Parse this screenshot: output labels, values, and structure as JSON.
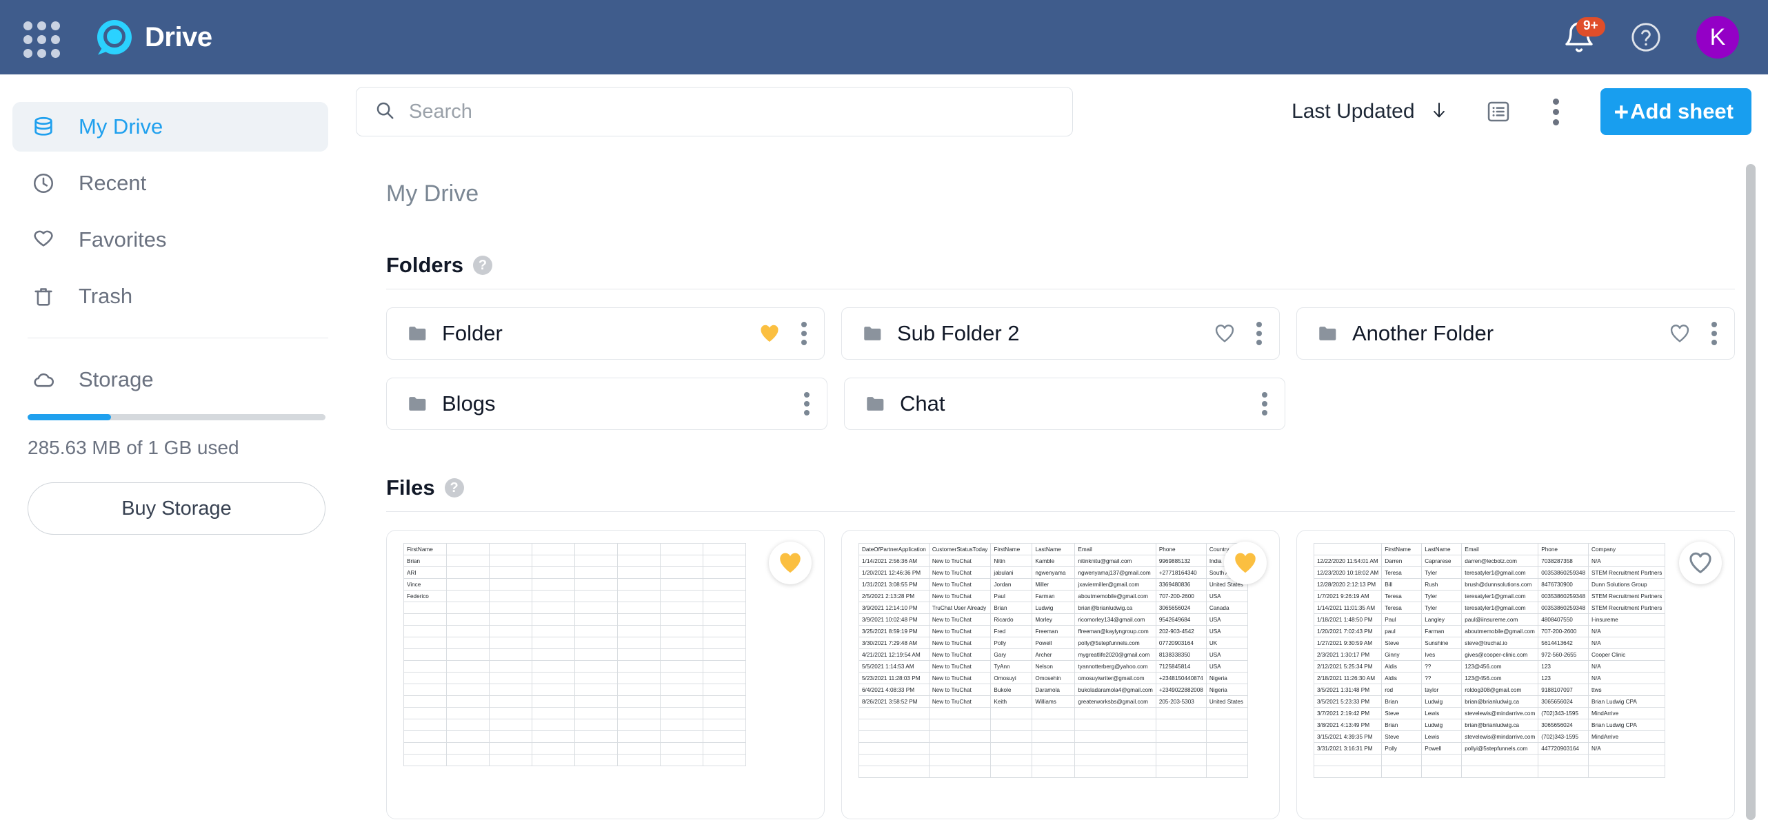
{
  "header": {
    "apps_icon": "apps-grid-icon",
    "logo_icon": "drive-logo-icon",
    "brand": "Drive",
    "notifications": {
      "icon": "bell-icon",
      "badge": "9+"
    },
    "help": {
      "icon": "help-circle-icon"
    },
    "avatar": {
      "initial": "K",
      "color": "#9400C6"
    }
  },
  "sidebar": {
    "items": [
      {
        "label": "My Drive",
        "icon": "database-icon",
        "active": true
      },
      {
        "label": "Recent",
        "icon": "clock-icon",
        "active": false
      },
      {
        "label": "Favorites",
        "icon": "heart-icon",
        "active": false
      },
      {
        "label": "Trash",
        "icon": "trash-icon",
        "active": false
      }
    ],
    "storage": {
      "label": "Storage",
      "icon": "cloud-icon",
      "usage_text": "285.63 MB of 1 GB used",
      "percent": 28,
      "bar_color": "#1FA0EE",
      "buy_label": "Buy Storage"
    }
  },
  "toolbar": {
    "search": {
      "placeholder": "Search",
      "value": "",
      "icon": "search-icon"
    },
    "sort_label": "Last Updated",
    "sort_direction_icon": "arrow-down-icon",
    "list_view_icon": "list-view-icon",
    "more_icon": "kebab-menu-icon",
    "add_sheet_label": "Add sheet",
    "add_sheet_plus": "+",
    "accent": "#189EEF"
  },
  "main": {
    "breadcrumb": "My Drive",
    "folders_section": {
      "title": "Folders",
      "help_glyph": "?",
      "items": [
        {
          "name": "Folder",
          "favorited": true,
          "has_heart": true,
          "icon": "folder-icon"
        },
        {
          "name": "Sub Folder 2",
          "favorited": false,
          "has_heart": true,
          "icon": "folder-icon"
        },
        {
          "name": "Another Folder",
          "favorited": false,
          "has_heart": true,
          "icon": "folder-icon"
        },
        {
          "name": "Blogs",
          "favorited": false,
          "has_heart": false,
          "icon": "folder-icon"
        },
        {
          "name": "Chat",
          "favorited": false,
          "has_heart": false,
          "icon": "folder-icon"
        }
      ]
    },
    "files_section": {
      "title": "Files",
      "help_glyph": "?",
      "items": [
        {
          "favorited": true,
          "sheet": {
            "columns": [
              "FirstName",
              "",
              "",
              "",
              "",
              "",
              "",
              ""
            ],
            "rows": [
              [
                "Brian",
                "",
                "",
                "",
                "",
                "",
                "",
                ""
              ],
              [
                "ARI",
                "",
                "",
                "",
                "",
                "",
                "",
                ""
              ],
              [
                "Vince",
                "",
                "",
                "",
                "",
                "",
                "",
                ""
              ],
              [
                "Federico",
                "",
                "",
                "",
                "",
                "",
                "",
                ""
              ]
            ],
            "blank_rows": 14
          }
        },
        {
          "favorited": true,
          "sheet": {
            "columns": [
              "DateOfPartnerApplication",
              "CustomerStatusToday",
              "FirstName",
              "LastName",
              "Email",
              "Phone",
              "Country"
            ],
            "rows": [
              [
                "1/14/2021 2:56:36 AM",
                "New to TruChat",
                "Nitin",
                "Kamble",
                "nitinknitu@gmail.com",
                "9969885132",
                "India"
              ],
              [
                "1/20/2021 12:46:36 PM",
                "New to TruChat",
                "jabulani",
                "ngwenyama",
                "ngwenyamaj137@gmail.com",
                "+27718164340",
                "South Africa"
              ],
              [
                "1/31/2021 3:08:55 PM",
                "New to TruChat",
                "Jordan",
                "Miller",
                "jxaviermiller@gmail.com",
                "3369480836",
                "United States"
              ],
              [
                "2/5/2021 2:13:28 PM",
                "New to TruChat",
                "Paul",
                "Farman",
                "aboutmemobile@gmail.com",
                "707-200-2600",
                "USA"
              ],
              [
                "3/9/2021 12:14:10 PM",
                "TruChat User Already",
                "Brian",
                "Ludwig",
                "brian@brianludwig.ca",
                "3065656024",
                "Canada"
              ],
              [
                "3/9/2021 10:02:48 PM",
                "New to TruChat",
                "Ricardo",
                "Morley",
                "ricomorley134@gmail.com",
                "9542649684",
                "USA"
              ],
              [
                "3/25/2021 8:59:19 PM",
                "New to TruChat",
                "Fred",
                "Freeman",
                "ffreeman@kaylyngroup.com",
                "202-903-4542",
                "USA"
              ],
              [
                "3/30/2021 7:29:48 AM",
                "New to TruChat",
                "Polly",
                "Powell",
                "polly@5stepfunnels.com",
                "07720903164",
                "UK"
              ],
              [
                "4/21/2021 12:19:54 AM",
                "New to TruChat",
                "Gary",
                "Archer",
                "mygreatlife2020@gmail.com",
                "8138338350",
                "USA"
              ],
              [
                "5/5/2021 1:14:53 AM",
                "New to TruChat",
                "TyAnn",
                "Nelson",
                "tyannotterberg@yahoo.com",
                "7125845814",
                "USA"
              ],
              [
                "5/23/2021 11:28:03 PM",
                "New to TruChat",
                "Omosuyi",
                "Omosehin",
                "omosuyiwriter@gmail.com",
                "+2348150440874",
                "Nigeria"
              ],
              [
                "6/4/2021 4:08:33 PM",
                "New to TruChat",
                "Bukole",
                "Daramola",
                "bukoladaramola4@gmail.com",
                "+2349022882008",
                "Nigeria"
              ],
              [
                "8/26/2021 3:58:52 PM",
                "New to TruChat",
                "Keith",
                "Williams",
                "greaterworksbs@gmail.com",
                "205-203-5303",
                "United States"
              ]
            ],
            "blank_rows": 6
          }
        },
        {
          "favorited": false,
          "sheet": {
            "columns": [
              "",
              "FirstName",
              "LastName",
              "Email",
              "Phone",
              "Company"
            ],
            "rows": [
              [
                "12/22/2020 11:54:01 AM",
                "Darren",
                "Caprarese",
                "darren@lecbotz.com",
                "7038287358",
                "N/A"
              ],
              [
                "12/23/2020 10:18:02 AM",
                "Teresa",
                "Tyler",
                "teresatyler1@gmail.com",
                "00353860259348",
                "STEM Recruitment Partners"
              ],
              [
                "12/28/2020 2:12:13 PM",
                "Bill",
                "Rush",
                "brush@dunnsolutions.com",
                "8476730900",
                "Dunn Solutions Group"
              ],
              [
                "1/7/2021 9:26:19 AM",
                "Teresa",
                "Tyler",
                "teresatyler1@gmail.com",
                "00353860259348",
                "STEM Recruitment Partners"
              ],
              [
                "1/14/2021 11:01:35 AM",
                "Teresa",
                "Tyler",
                "teresatyler1@gmail.com",
                "00353860259348",
                "STEM Recruitment Partners"
              ],
              [
                "1/18/2021 1:48:50 PM",
                "Paul",
                "Langley",
                "paul@iinsureme.com",
                "4808407550",
                "I-insureme"
              ],
              [
                "1/20/2021 7:02:43 PM",
                "paul",
                "Farman",
                "aboutmemobile@gmail.com",
                "707-200-2600",
                "N/A"
              ],
              [
                "1/27/2021 9:30:59 AM",
                "Steve",
                "Sunshine",
                "steve@truchat.io",
                "5614413642",
                "N/A"
              ],
              [
                "2/3/2021 1:30:17 PM",
                "Ginny",
                "Ives",
                "gives@cooper-clinic.com",
                "972-560-2655",
                "Cooper Clinic"
              ],
              [
                "2/12/2021 5:25:34 PM",
                "Aldis",
                "??",
                "123@456.com",
                "123",
                "N/A"
              ],
              [
                "2/18/2021 11:26:30 AM",
                "Aldis",
                "??",
                "123@456.com",
                "123",
                "N/A"
              ],
              [
                "3/5/2021 1:31:48 PM",
                "rod",
                "taylor",
                "roldog308@gmail.com",
                "9188107097",
                "ttws"
              ],
              [
                "3/5/2021 5:23:33 PM",
                "Brian",
                "Ludwig",
                "brian@brianludwig.ca",
                "3065656024",
                "Brian Ludwig CPA"
              ],
              [
                "3/7/2021 2:19:42 PM",
                "Steve",
                "Lewis",
                "stevelewis@mindarrive.com",
                "(702)343-1595",
                "MindArrive"
              ],
              [
                "3/8/2021 4:13:49 PM",
                "Brian",
                "Ludwig",
                "brian@brianludwig.ca",
                "3065656024",
                "Brian Ludwig CPA"
              ],
              [
                "3/15/2021 4:39:35 PM",
                "Steve",
                "Lewis",
                "stevelewis@mindarrive.com",
                "(702)343-1595",
                "MindArrive"
              ],
              [
                "3/31/2021 3:16:31 PM",
                "Polly",
                "Powell",
                "pollyi@5stepfunnels.com",
                "447720903164",
                "N/A"
              ]
            ],
            "blank_rows": 2
          }
        }
      ]
    }
  },
  "colors": {
    "topbar": "#3F5C8C",
    "accent_blue": "#189EEF",
    "heart_yellow": "#FBBF40",
    "badge_red": "#E04E2A"
  }
}
